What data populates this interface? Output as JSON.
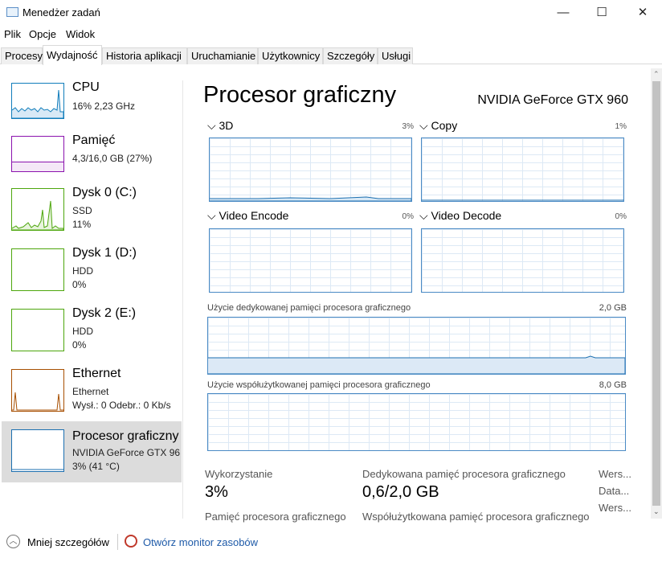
{
  "window": {
    "title": "Menedżer zadań",
    "min": "—",
    "max": "☐",
    "close": "✕"
  },
  "menu": [
    "Plik",
    "Opcje",
    "Widok"
  ],
  "tabs": [
    "Procesy",
    "Wydajność",
    "Historia aplikacji",
    "Uruchamianie",
    "Użytkownicy",
    "Szczegóły",
    "Usługi"
  ],
  "colors": {
    "cpu": "#117dbb",
    "memory": "#8b12ae",
    "disk": "#4da60c",
    "ethernet": "#a74f01",
    "gpu": "#1c6fb0"
  },
  "sidebar": [
    {
      "name": "CPU",
      "lines": [
        "16%  2,23 GHz"
      ]
    },
    {
      "name": "Pamięć",
      "lines": [
        "4,3/16,0 GB (27%)"
      ]
    },
    {
      "name": "Dysk 0 (C:)",
      "lines": [
        "SSD",
        "11%"
      ]
    },
    {
      "name": "Dysk 1 (D:)",
      "lines": [
        "HDD",
        "0%"
      ]
    },
    {
      "name": "Dysk 2 (E:)",
      "lines": [
        "HDD",
        "0%"
      ]
    },
    {
      "name": "Ethernet",
      "lines": [
        "Ethernet",
        "Wysł.: 0 Odebr.: 0 Kb/s"
      ]
    },
    {
      "name": "Procesor graficzny",
      "lines": [
        "NVIDIA GeForce GTX 96",
        "3% (41 °C)"
      ]
    }
  ],
  "main": {
    "title": "Procesor graficzny",
    "device": "NVIDIA GeForce GTX 960",
    "engines": [
      {
        "label": "3D",
        "pct": "3%"
      },
      {
        "label": "Copy",
        "pct": "1%"
      },
      {
        "label": "Video Encode",
        "pct": "0%"
      },
      {
        "label": "Video Decode",
        "pct": "0%"
      }
    ],
    "dedicated": {
      "label": "Użycie dedykowanej pamięci procesora graficznego",
      "max": "2,0 GB"
    },
    "shared": {
      "label": "Użycie współużytkowanej pamięci procesora graficznego",
      "max": "8,0 GB"
    },
    "stats": {
      "util_label": "Wykorzystanie",
      "util": "3%",
      "ded_label": "Dedykowana pamięć procesora graficznego",
      "ded": "0,6/2,0 GB",
      "gpumem_label": "Pamięć procesora graficznego",
      "shared_label": "Współużytkowana pamięć procesora graficznego",
      "side": [
        "Wers...",
        "Data...",
        "Wers..."
      ]
    }
  },
  "footer": {
    "less": "Mniej szczegółów",
    "monitor": "Otwórz monitor zasobów"
  }
}
